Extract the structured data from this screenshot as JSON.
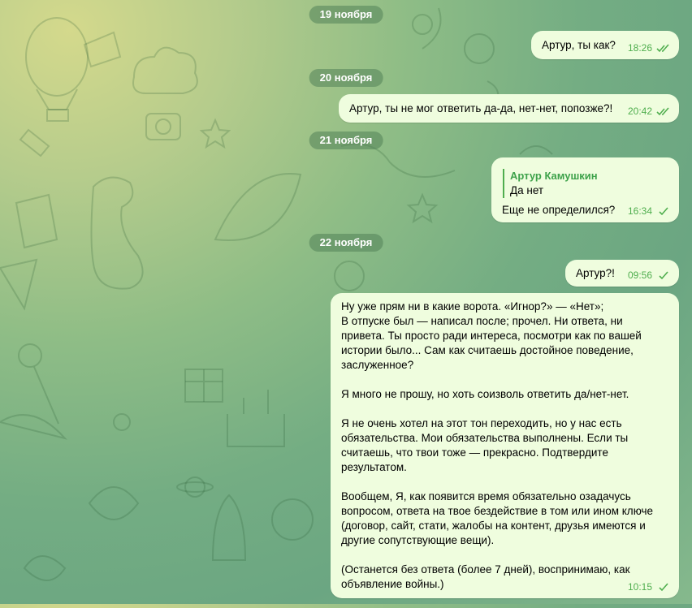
{
  "dates": [
    "19 ноября",
    "20 ноября",
    "21 ноября",
    "22 ноября"
  ],
  "messages": [
    {
      "text": "Артур, ты как?",
      "time": "18:26",
      "status": "read"
    },
    {
      "text": "Артур, ты не мог ответить да-да, нет-нет, попозже?!",
      "time": "20:42",
      "status": "read"
    },
    {
      "reply_author": "Артур Камушкин",
      "reply_text": "Да нет",
      "text": "Еще не определился?",
      "time": "16:34",
      "status": "sent"
    },
    {
      "text": "Артур?!",
      "time": "09:56",
      "status": "sent"
    },
    {
      "text": "Ну уже прям ни в какие ворота. «Игнор?» — «Нет»;\nВ отпуске был — написал после; прочел. Ни ответа, ни привета. Ты просто ради интереса, посмотри как по вашей истории было... Сам как считаешь достойное поведение, заслуженное?\n\nЯ много не прошу, но хоть соизволь ответить да/нет-нет.\n\nЯ не очень хотел на этот тон переходить, но у нас есть обязательства. Мои обязательства выполнены. Если ты считаешь, что твои тоже — прекрасно. Подтвердите результатом.\n\nВообщем, Я, как появится время обязательно озадачусь вопросом, ответа на твое бездействие в том или ином ключе (договор, сайт, стати, жалобы на контент, друзья имеются и другие сопутствующие вещи).\n\n(Останется без ответа (более 7 дней), воспринимаю, как объявление войны.)",
      "time": "10:15",
      "status": "sent"
    }
  ],
  "colors": {
    "bubble": "#effdde",
    "accent": "#4fae4e",
    "date_pill": "#528258"
  }
}
